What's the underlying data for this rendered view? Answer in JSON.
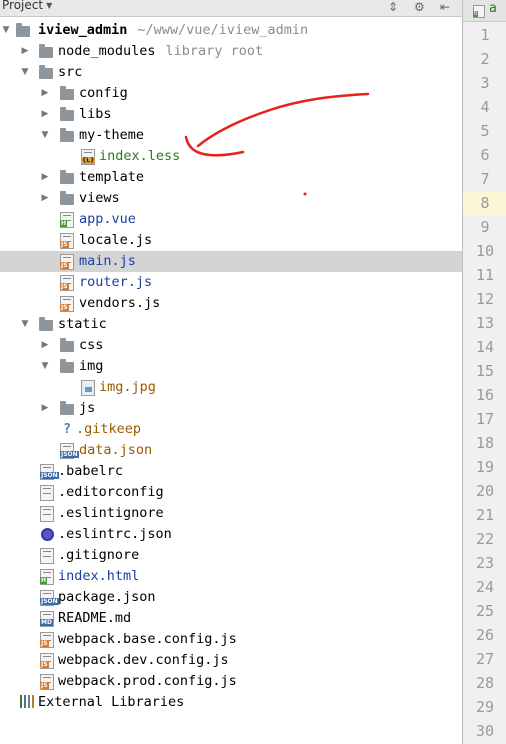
{
  "toolbar": {
    "title": "Project"
  },
  "tree": {
    "root": {
      "name": "iview_admin",
      "hint": "~/www/vue/iview_admin"
    },
    "items": [
      {
        "label": "node_modules",
        "hint": "library root"
      },
      {
        "label": "src"
      },
      {
        "label": "config"
      },
      {
        "label": "libs"
      },
      {
        "label": "my-theme"
      },
      {
        "label": "index.less"
      },
      {
        "label": "template"
      },
      {
        "label": "views"
      },
      {
        "label": "app.vue"
      },
      {
        "label": "locale.js"
      },
      {
        "label": "main.js"
      },
      {
        "label": "router.js"
      },
      {
        "label": "vendors.js"
      },
      {
        "label": "static"
      },
      {
        "label": "css"
      },
      {
        "label": "img"
      },
      {
        "label": "img.jpg"
      },
      {
        "label": "js"
      },
      {
        "label": ".gitkeep"
      },
      {
        "label": "data.json"
      },
      {
        "label": ".babelrc"
      },
      {
        "label": ".editorconfig"
      },
      {
        "label": ".eslintignore"
      },
      {
        "label": ".eslintrc.json"
      },
      {
        "label": ".gitignore"
      },
      {
        "label": "index.html"
      },
      {
        "label": "package.json"
      },
      {
        "label": "README.md"
      },
      {
        "label": "webpack.base.config.js"
      },
      {
        "label": "webpack.dev.config.js"
      },
      {
        "label": "webpack.prod.config.js"
      },
      {
        "label": "External Libraries"
      }
    ],
    "selected": "main.js"
  },
  "editor": {
    "tab_label": "a",
    "tab_file_type": "H",
    "line_numbers": [
      "1",
      "2",
      "3",
      "4",
      "5",
      "6",
      "7",
      "8",
      "9",
      "10",
      "11",
      "12",
      "13",
      "14",
      "15",
      "16",
      "17",
      "18",
      "19",
      "20",
      "21",
      "22",
      "23",
      "24",
      "25",
      "26",
      "27",
      "28",
      "29",
      "30"
    ],
    "current_line": 8
  },
  "colors": {
    "selection": "#d4d4d4",
    "annotation": "#e8211b",
    "current_line": "#fbf6d6"
  }
}
